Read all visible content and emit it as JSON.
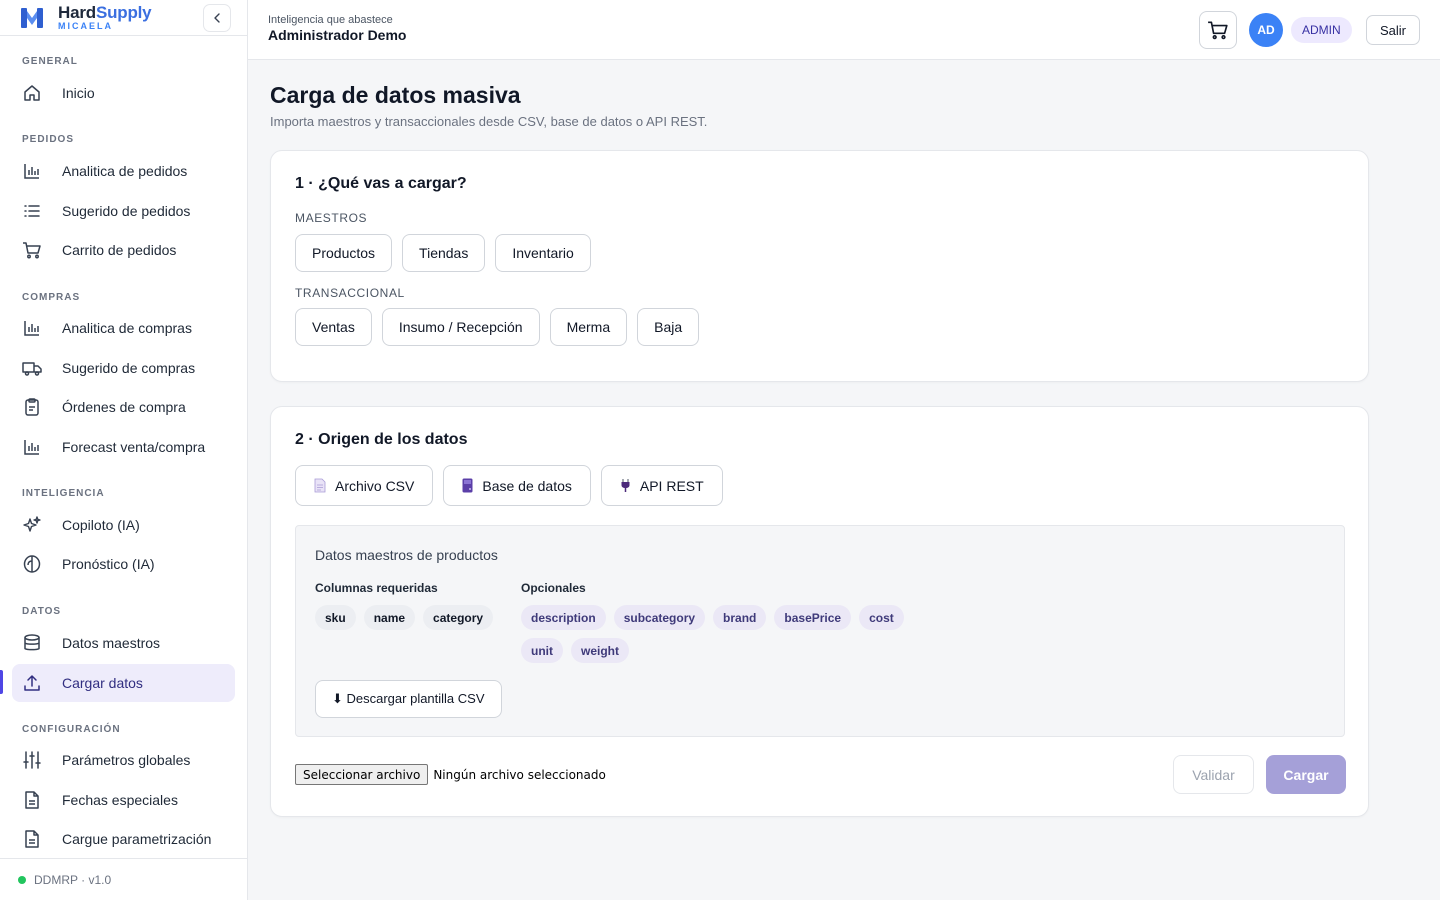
{
  "brand": {
    "name_part1": "Hard",
    "name_part2": "Supply",
    "subtitle": "MICAELA"
  },
  "sidebar": {
    "sections": [
      {
        "title": "GENERAL",
        "items": [
          {
            "label": "Inicio",
            "icon": "home-icon"
          }
        ]
      },
      {
        "title": "PEDIDOS",
        "items": [
          {
            "label": "Analitica de pedidos",
            "icon": "bar-chart-icon"
          },
          {
            "label": "Sugerido de pedidos",
            "icon": "list-icon"
          },
          {
            "label": "Carrito de pedidos",
            "icon": "cart-icon"
          }
        ]
      },
      {
        "title": "COMPRAS",
        "items": [
          {
            "label": "Analitica de compras",
            "icon": "bar-chart-icon"
          },
          {
            "label": "Sugerido de compras",
            "icon": "truck-icon"
          },
          {
            "label": "Órdenes de compra",
            "icon": "clipboard-icon"
          },
          {
            "label": "Forecast venta/compra",
            "icon": "bar-chart-icon"
          }
        ]
      },
      {
        "title": "INTELIGENCIA",
        "items": [
          {
            "label": "Copiloto (IA)",
            "icon": "sparkles-icon"
          },
          {
            "label": "Pronóstico (IA)",
            "icon": "brain-icon"
          }
        ]
      },
      {
        "title": "DATOS",
        "items": [
          {
            "label": "Datos maestros",
            "icon": "database-icon"
          },
          {
            "label": "Cargar datos",
            "icon": "upload-icon",
            "active": true
          }
        ]
      },
      {
        "title": "CONFIGURACIÓN",
        "items": [
          {
            "label": "Parámetros globales",
            "icon": "sliders-icon"
          },
          {
            "label": "Fechas especiales",
            "icon": "file-icon"
          },
          {
            "label": "Cargue parametrización",
            "icon": "file-icon"
          }
        ]
      }
    ],
    "footer": "DDMRP · v1.0",
    "status_color": "#22c55e"
  },
  "header": {
    "subtitle": "Inteligencia que abastece",
    "title": "Administrador Demo",
    "avatar": "AD",
    "role": "ADMIN",
    "logout": "Salir"
  },
  "page": {
    "title": "Carga de datos masiva",
    "subtitle": "Importa maestros y transaccionales desde CSV, base de datos o API REST."
  },
  "step1": {
    "title": "1 · ¿Qué vas a cargar?",
    "masters_label": "MAESTROS",
    "masters": [
      "Productos",
      "Tiendas",
      "Inventario"
    ],
    "trans_label": "TRANSACCIONAL",
    "transactional": [
      "Ventas",
      "Insumo / Recepción",
      "Merma",
      "Baja"
    ]
  },
  "step2": {
    "title": "2 · Origen de los datos",
    "sources": [
      {
        "label": "Archivo CSV",
        "icon": "document-icon"
      },
      {
        "label": "Base de datos",
        "icon": "database-icon"
      },
      {
        "label": "API REST",
        "icon": "plug-icon"
      }
    ],
    "panel_title": "Datos maestros de productos",
    "required_label": "Columnas requeridas",
    "required": [
      "sku",
      "name",
      "category"
    ],
    "optional_label": "Opcionales",
    "optional": [
      "description",
      "subcategory",
      "brand",
      "basePrice",
      "cost",
      "unit",
      "weight"
    ],
    "download": "⬇ Descargar plantilla CSV",
    "file_button": "Seleccionar archivo",
    "file_status": "Ningún archivo seleccionado",
    "validate": "Validar",
    "upload": "Cargar"
  },
  "colors": {
    "accent": "#4f46e5",
    "brand_blue": "#3b6fe0",
    "upload_disabled": "#a5a0d8"
  }
}
